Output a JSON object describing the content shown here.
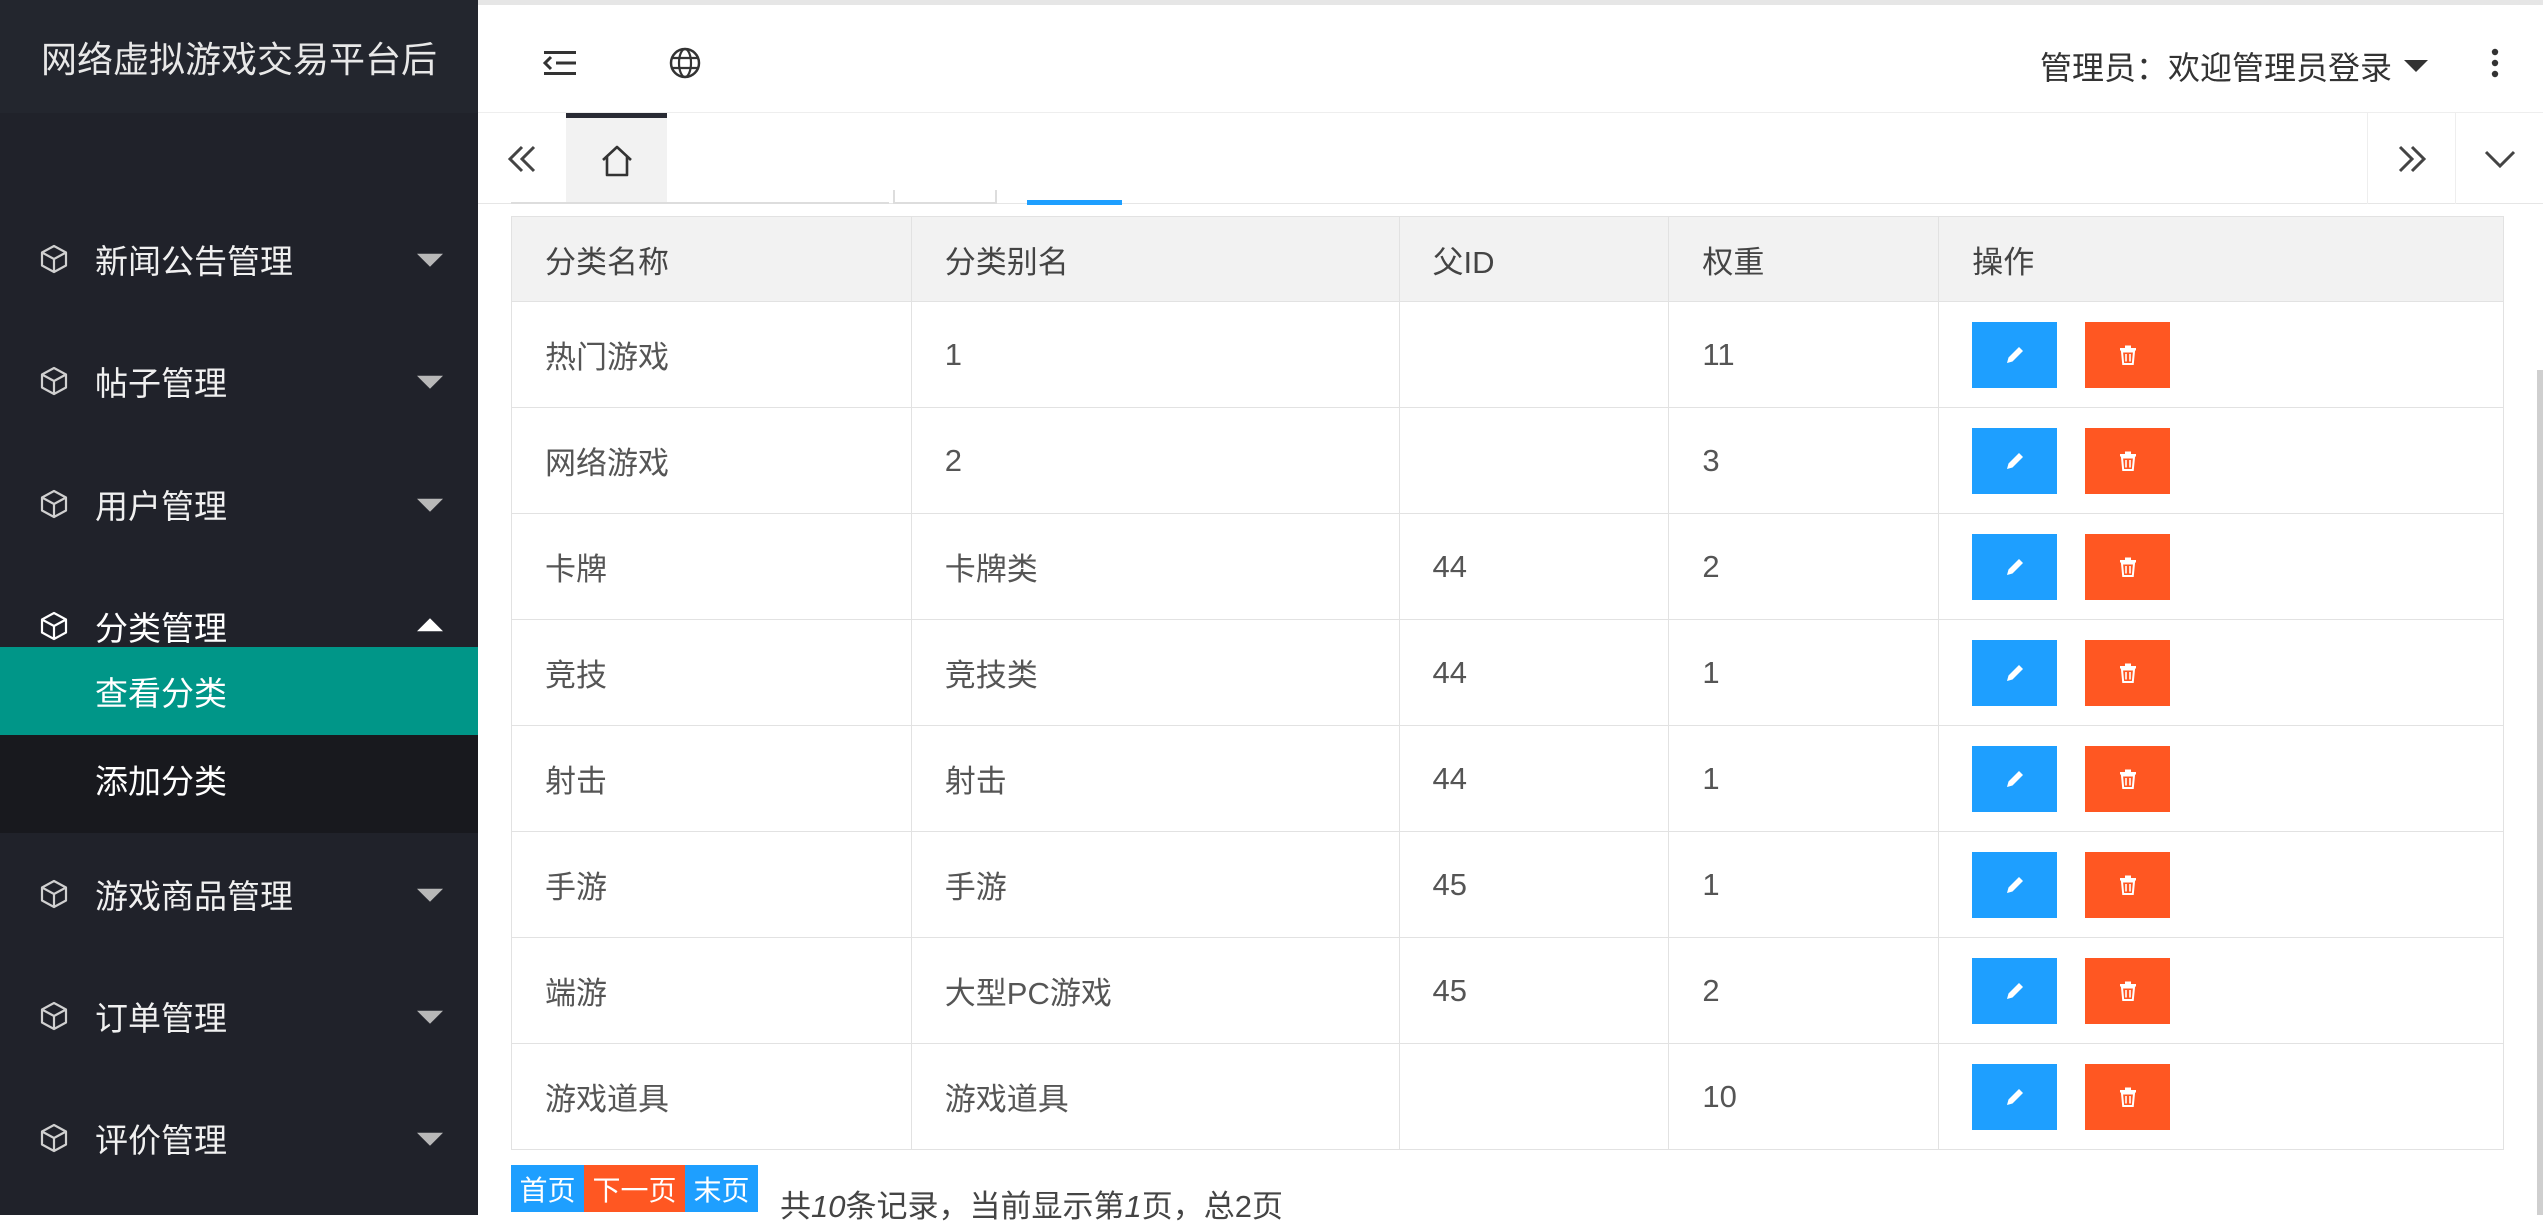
{
  "app": {
    "title": "网络虚拟游戏交易平台后"
  },
  "sidebar": {
    "menus": [
      {
        "label": "新闻公告管理",
        "expanded": false
      },
      {
        "label": "帖子管理",
        "expanded": false
      },
      {
        "label": "用户管理",
        "expanded": false
      },
      {
        "label": "分类管理",
        "expanded": true
      },
      {
        "label": "游戏商品管理",
        "expanded": false
      },
      {
        "label": "订单管理",
        "expanded": false
      },
      {
        "label": "评价管理",
        "expanded": false
      }
    ],
    "submenu": [
      {
        "label": "查看分类",
        "active": true
      },
      {
        "label": "添加分类",
        "active": false
      }
    ]
  },
  "header": {
    "admin_label": "管理员：欢迎管理员登录"
  },
  "table": {
    "columns": [
      "分类名称",
      "分类别名",
      "父ID",
      "权重",
      "操作"
    ],
    "rows": [
      [
        "热门游戏",
        "1",
        "",
        "11"
      ],
      [
        "网络游戏",
        "2",
        "",
        "3"
      ],
      [
        "卡牌",
        "卡牌类",
        "44",
        "2"
      ],
      [
        "竞技",
        "竞技类",
        "44",
        "1"
      ],
      [
        "射击",
        "射击",
        "44",
        "1"
      ],
      [
        "手游",
        "手游",
        "45",
        "1"
      ],
      [
        "端游",
        "大型PC游戏",
        "45",
        "2"
      ],
      [
        "游戏道具",
        "游戏道具",
        "",
        "10"
      ]
    ]
  },
  "pagination": {
    "first": "首页",
    "next": "下一页",
    "last": "末页",
    "info_prefix": "共",
    "total_records": "10",
    "info_mid": "条记录，当前显示第",
    "current_page": "1",
    "info_suffix": "页，总2页"
  },
  "colors": {
    "sidebar_bg": "#20222a",
    "active_green": "#009688",
    "edit_blue": "#1e9fff",
    "delete_orange": "#ff5722"
  }
}
